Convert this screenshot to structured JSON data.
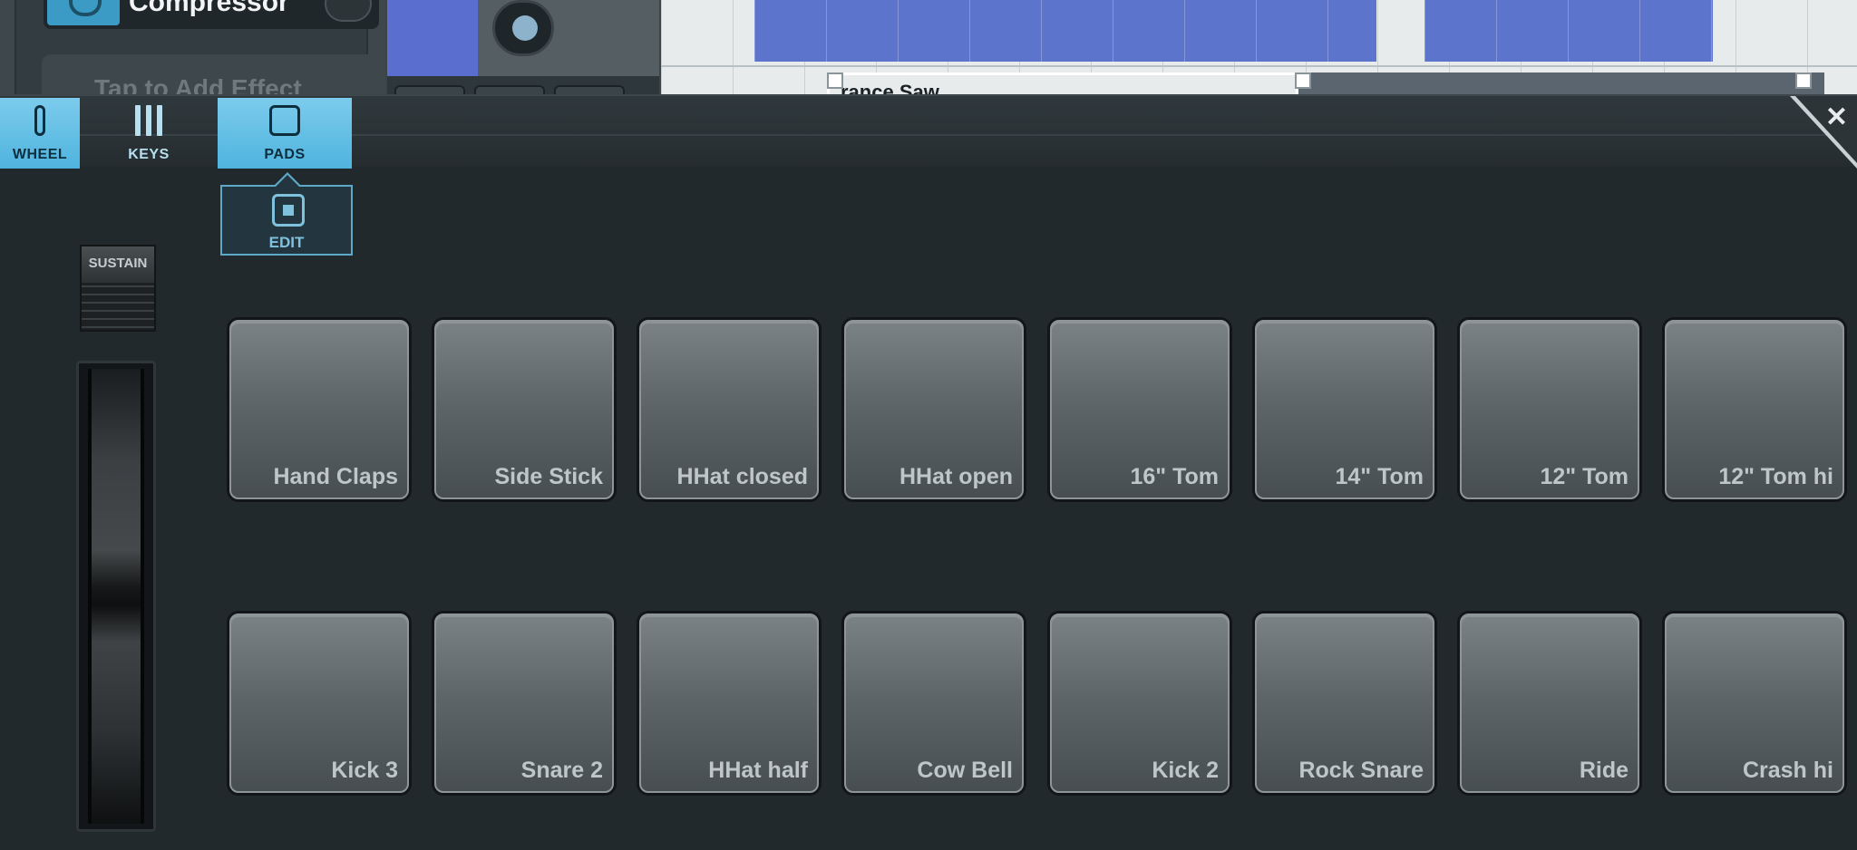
{
  "background": {
    "effect": {
      "name": "Compressor",
      "add_effect_label": "Tap to Add Effect"
    },
    "region_label": "rance Saw"
  },
  "tabs": [
    {
      "id": "wheel",
      "label": "WHEEL",
      "active": true,
      "icon": "wheel-icon"
    },
    {
      "id": "keys",
      "label": "KEYS",
      "active": false,
      "icon": "keys-icon"
    },
    {
      "id": "pads",
      "label": "PADS",
      "active": true,
      "icon": "pads-icon"
    }
  ],
  "edit_label": "EDIT",
  "close_icon": "close-icon",
  "sustain_label": "SUSTAIN",
  "pads": {
    "row1": [
      "Hand Claps",
      "Side Stick",
      "HHat closed",
      "HHat open",
      "16\" Tom",
      "14\" Tom",
      "12\" Tom",
      "12\" Tom hi"
    ],
    "row2": [
      "Kick 3",
      "Snare 2",
      "HHat half",
      "Cow Bell",
      "Kick 2",
      "Rock Snare",
      "Ride",
      "Crash hi"
    ]
  },
  "colors": {
    "accent": "#5bb8e0",
    "panel": "#22292c",
    "pad": "#5e6669"
  }
}
